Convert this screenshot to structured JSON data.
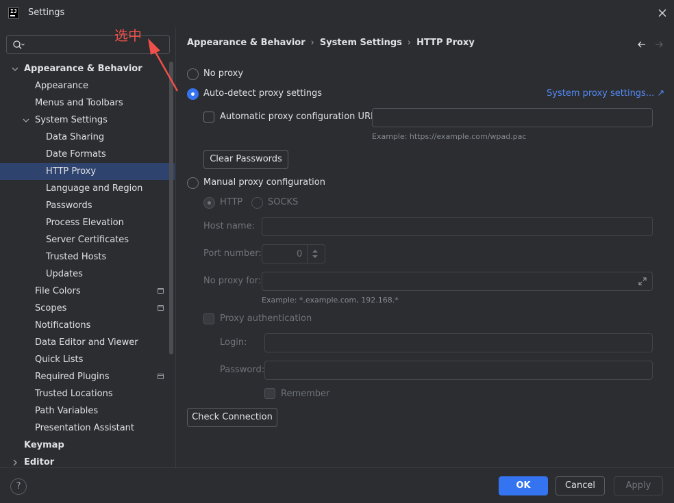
{
  "window": {
    "title": "Settings",
    "app_icon_text": "IJ"
  },
  "annotation": {
    "text": "选中",
    "color": "#f0504a"
  },
  "search": {
    "placeholder": "",
    "value": ""
  },
  "tree": [
    {
      "label": "Appearance & Behavior",
      "level": 0,
      "bold": true,
      "expander": "expanded"
    },
    {
      "label": "Appearance",
      "level": 1
    },
    {
      "label": "Menus and Toolbars",
      "level": 1
    },
    {
      "label": "System Settings",
      "level": 1,
      "expander": "expanded"
    },
    {
      "label": "Data Sharing",
      "level": 2
    },
    {
      "label": "Date Formats",
      "level": 2
    },
    {
      "label": "HTTP Proxy",
      "level": 2,
      "selected": true
    },
    {
      "label": "Language and Region",
      "level": 2
    },
    {
      "label": "Passwords",
      "level": 2
    },
    {
      "label": "Process Elevation",
      "level": 2
    },
    {
      "label": "Server Certificates",
      "level": 2
    },
    {
      "label": "Trusted Hosts",
      "level": 2
    },
    {
      "label": "Updates",
      "level": 2
    },
    {
      "label": "File Colors",
      "level": 1,
      "project_icon": true
    },
    {
      "label": "Scopes",
      "level": 1,
      "project_icon": true
    },
    {
      "label": "Notifications",
      "level": 1
    },
    {
      "label": "Data Editor and Viewer",
      "level": 1
    },
    {
      "label": "Quick Lists",
      "level": 1
    },
    {
      "label": "Required Plugins",
      "level": 1,
      "project_icon": true
    },
    {
      "label": "Trusted Locations",
      "level": 1
    },
    {
      "label": "Path Variables",
      "level": 1
    },
    {
      "label": "Presentation Assistant",
      "level": 1
    },
    {
      "label": "Keymap",
      "level": 0,
      "bold": true
    },
    {
      "label": "Editor",
      "level": 0,
      "bold": true,
      "expander": "collapsed"
    }
  ],
  "breadcrumb": {
    "part1": "Appearance & Behavior",
    "part2": "System Settings",
    "part3": "HTTP Proxy",
    "separator": "›"
  },
  "proxy": {
    "no_proxy_label": "No proxy",
    "auto_detect_label": "Auto-detect proxy settings",
    "system_proxy_link": "System proxy settings... ↗",
    "auto_config_url_label": "Automatic proxy configuration URL:",
    "auto_config_url_value": "",
    "auto_config_example": "Example: https://example.com/wpad.pac",
    "clear_passwords_label": "Clear Passwords",
    "manual_label": "Manual proxy configuration",
    "http_label": "HTTP",
    "socks_label": "SOCKS",
    "host_name_label": "Host name:",
    "host_name_value": "",
    "port_number_label": "Port number:",
    "port_number_value": "0",
    "no_proxy_for_label": "No proxy for:",
    "no_proxy_for_value": "",
    "no_proxy_example": "Example: *.example.com, 192.168.*",
    "proxy_auth_label": "Proxy authentication",
    "login_label": "Login:",
    "login_value": "",
    "password_label": "Password:",
    "password_value": "",
    "remember_label": "Remember",
    "check_connection_label": "Check Connection",
    "selected_mode": "auto-detect"
  },
  "footer": {
    "help_label": "?",
    "ok_label": "OK",
    "cancel_label": "Cancel",
    "apply_label": "Apply"
  },
  "colors": {
    "accent": "#3574f0",
    "selection": "#2e436e",
    "link": "#548af7",
    "background": "#2b2d30"
  }
}
